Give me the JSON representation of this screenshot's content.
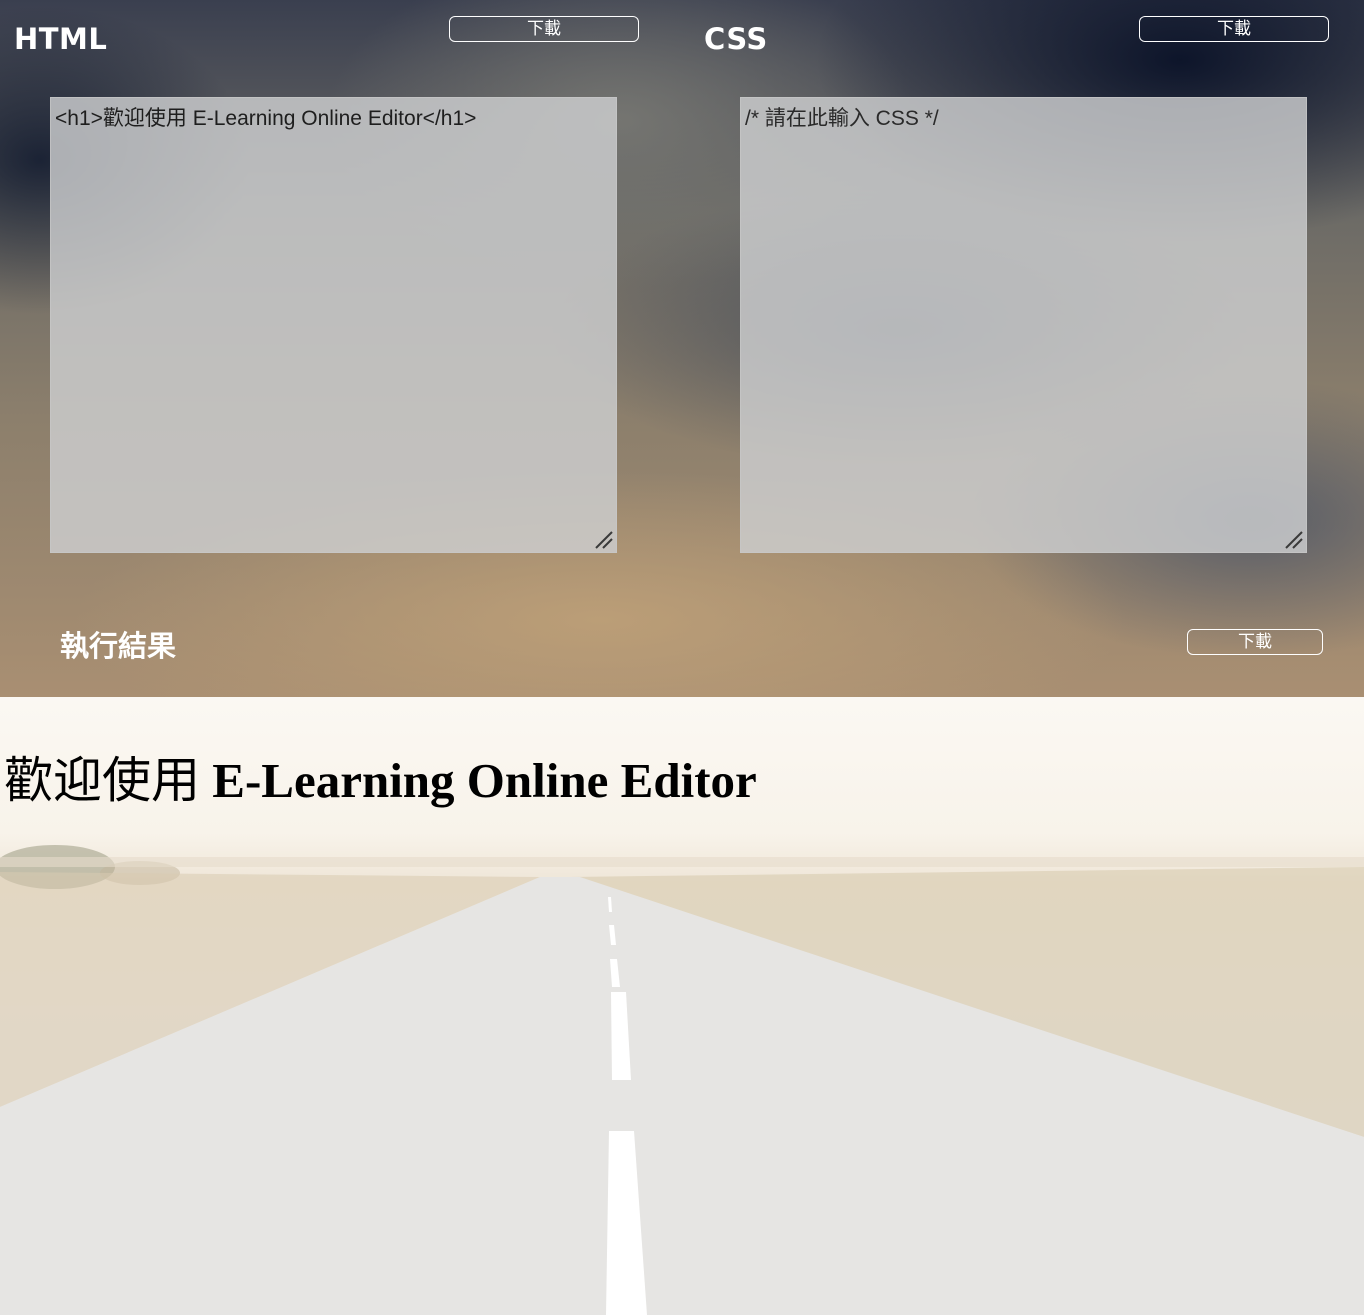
{
  "html_pane": {
    "title": "HTML",
    "download_label": "下載",
    "editor_value": "<h1>歡迎使用 E-Learning Online Editor</h1>"
  },
  "css_pane": {
    "title": "CSS",
    "download_label": "下載",
    "editor_value": "/* 請在此輸入 CSS */"
  },
  "result_pane": {
    "title": "執行結果",
    "download_label": "下載",
    "heading_cjk": "歡迎使用",
    "heading_latin": " E-Learning Online Editor"
  },
  "icons": {
    "resize_grip": "resize-grip-icon"
  },
  "colors": {
    "text_on_bg": "#ffffff",
    "editor_bg": "#cdced0",
    "result_text": "#000000"
  }
}
